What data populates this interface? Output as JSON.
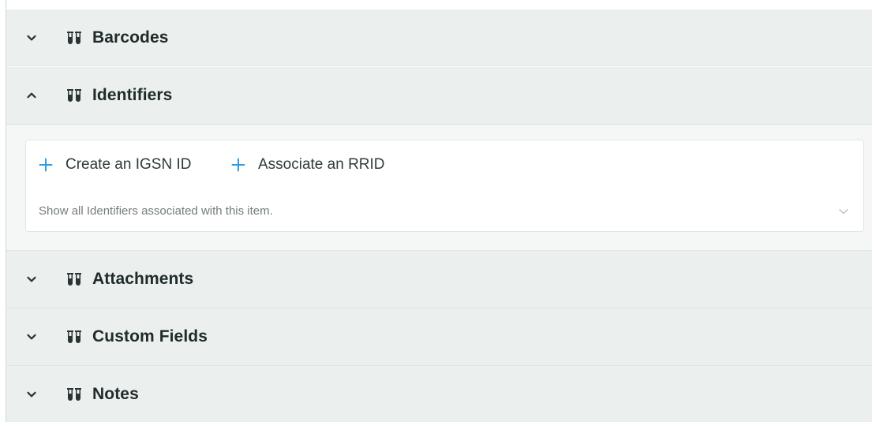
{
  "sections": [
    {
      "title": "Barcodes",
      "expanded": false,
      "toggle_icon": "chevron-down-icon",
      "section_icon": "sample-tubes-icon"
    },
    {
      "title": "Identifiers",
      "expanded": true,
      "toggle_icon": "chevron-up-icon",
      "section_icon": "sample-tubes-icon"
    },
    {
      "title": "Attachments",
      "expanded": false,
      "toggle_icon": "chevron-down-icon",
      "section_icon": "sample-tubes-icon"
    },
    {
      "title": "Custom Fields",
      "expanded": false,
      "toggle_icon": "chevron-down-icon",
      "section_icon": "sample-tubes-icon"
    },
    {
      "title": "Notes",
      "expanded": false,
      "toggle_icon": "chevron-down-icon",
      "section_icon": "sample-tubes-icon"
    }
  ],
  "identifiers": {
    "actions": [
      {
        "label": "Create an IGSN ID",
        "icon": "plus-icon"
      },
      {
        "label": "Associate an RRID",
        "icon": "plus-icon"
      }
    ],
    "description": "Show all Identifiers associated with this item.",
    "expand_icon": "chevron-down-icon"
  },
  "colors": {
    "header_bg": "#ebf0ee",
    "body_bg": "#f4f7f6",
    "accent_plus": "#2f9ee0",
    "title_text": "#1f2a2a",
    "muted_text": "#757d7c"
  }
}
